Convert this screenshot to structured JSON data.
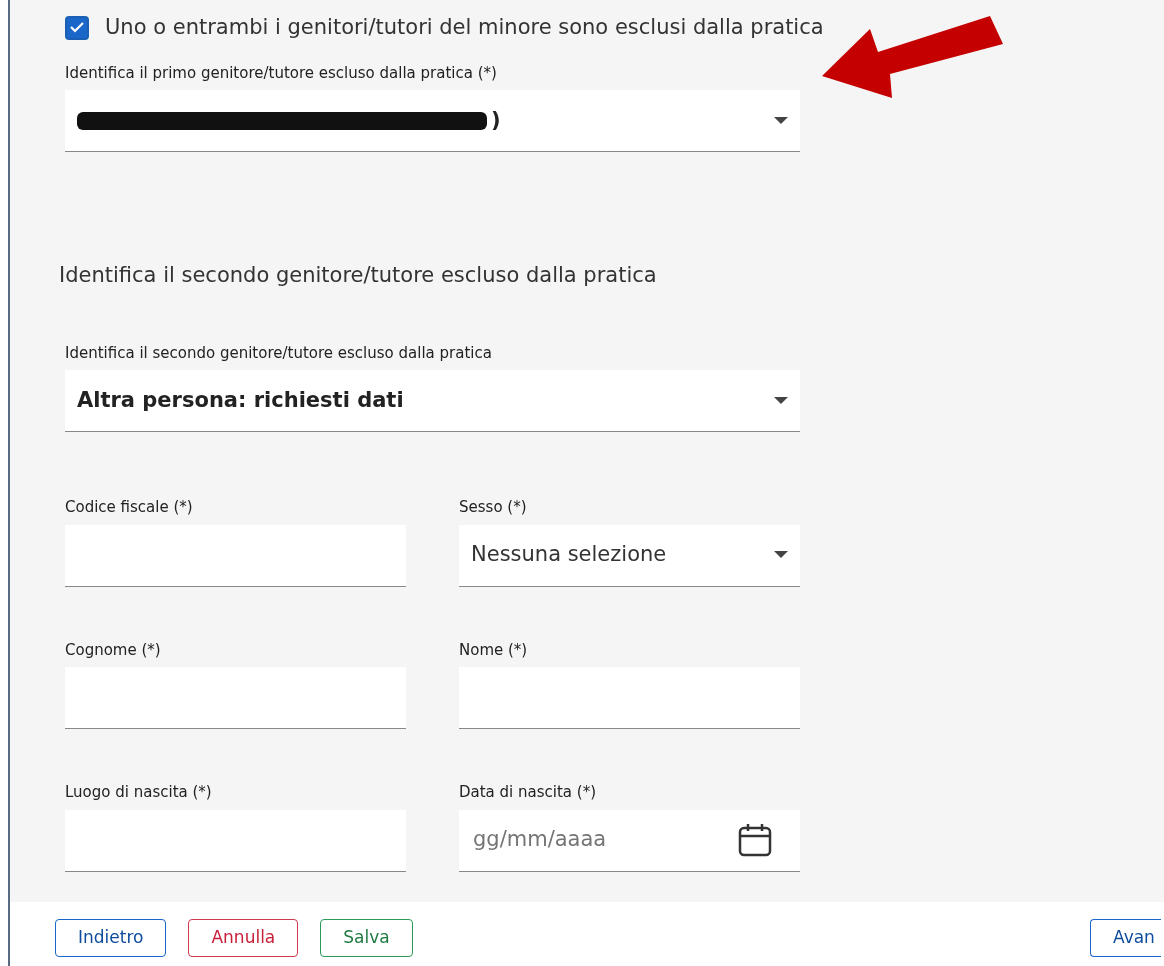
{
  "checkbox": {
    "label": "Uno o entrambi i genitori/tutori del minore sono esclusi dalla pratica",
    "checked": true
  },
  "first_parent": {
    "label": "Identifica il primo genitore/tutore escluso dalla pratica (*)",
    "value": ")",
    "redacted": true
  },
  "section_title": "Identifica il secondo genitore/tutore escluso dalla pratica",
  "second_parent": {
    "label": "Identifica il secondo genitore/tutore escluso dalla pratica",
    "value": "Altra persona: richiesti dati"
  },
  "fields": [
    {
      "kind": "text",
      "label": "Codice fiscale (*)"
    },
    {
      "kind": "select",
      "label": "Sesso (*)",
      "value": "Nessuna selezione"
    },
    {
      "kind": "text",
      "label": "Cognome (*)"
    },
    {
      "kind": "text",
      "label": "Nome (*)"
    },
    {
      "kind": "text",
      "label": "Luogo di nascita (*)"
    },
    {
      "kind": "date",
      "label": "Data di nascita (*)",
      "placeholder": "gg/mm/aaaa"
    }
  ],
  "buttons": [
    {
      "label": "Indietro",
      "kind": "back"
    },
    {
      "label": "Annulla",
      "kind": "cancel"
    },
    {
      "label": "Salva",
      "kind": "save"
    },
    {
      "label": "Avan",
      "kind": "next"
    }
  ]
}
